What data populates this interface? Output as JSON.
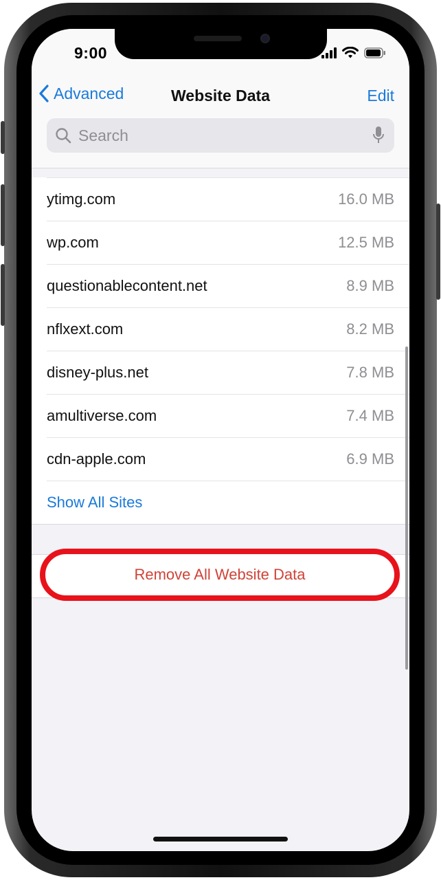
{
  "status": {
    "time": "9:00"
  },
  "nav": {
    "back_label": "Advanced",
    "title": "Website Data",
    "edit_label": "Edit"
  },
  "search": {
    "placeholder": "Search",
    "value": ""
  },
  "sites": [
    {
      "domain": "ytimg.com",
      "size": "16.0 MB"
    },
    {
      "domain": "wp.com",
      "size": "12.5 MB"
    },
    {
      "domain": "questionablecontent.net",
      "size": "8.9 MB"
    },
    {
      "domain": "nflxext.com",
      "size": "8.2 MB"
    },
    {
      "domain": "disney-plus.net",
      "size": "7.8 MB"
    },
    {
      "domain": "amultiverse.com",
      "size": "7.4 MB"
    },
    {
      "domain": "cdn-apple.com",
      "size": "6.9 MB"
    }
  ],
  "show_all_label": "Show All Sites",
  "remove_all_label": "Remove All Website Data",
  "colors": {
    "accent": "#1a7ad9",
    "destructive": "#cf4337",
    "highlight_ring": "#e8121b"
  }
}
